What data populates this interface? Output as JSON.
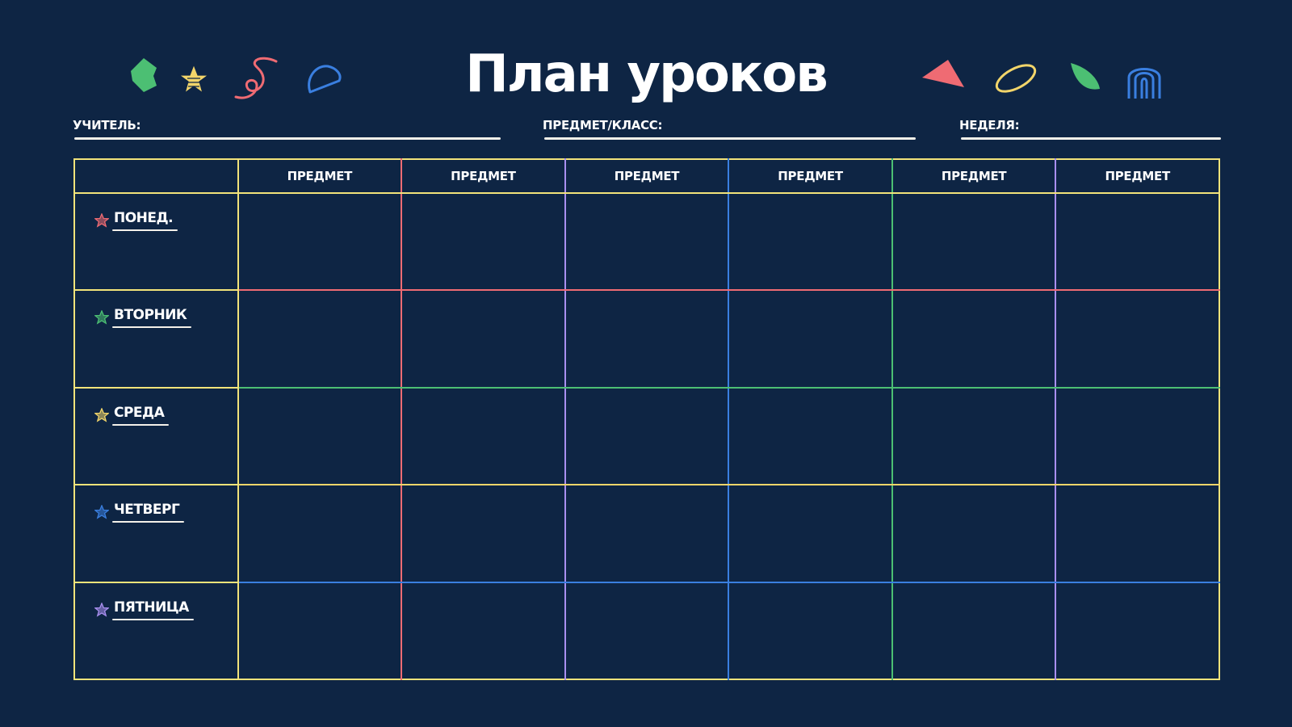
{
  "title": "План уроков",
  "fields": {
    "teacher_label": "УЧИТЕЛЬ:",
    "subject_label": "ПРЕДМЕТ/КЛАСС:",
    "week_label": "НЕДЕЛЯ:"
  },
  "table": {
    "columns": [
      "ПРЕДМЕТ",
      "ПРЕДМЕТ",
      "ПРЕДМЕТ",
      "ПРЕДМЕТ",
      "ПРЕДМЕТ",
      "ПРЕДМЕТ"
    ],
    "days": [
      {
        "label": "ПОНЕД.",
        "color": "#ef6b73"
      },
      {
        "label": "ВТОРНИК",
        "color": "#4cbf73"
      },
      {
        "label": "СРЕДА",
        "color": "#f2d56a"
      },
      {
        "label": "ЧЕТВЕРГ",
        "color": "#3a7fe0"
      },
      {
        "label": "ПЯТНИЦА",
        "color": "#a98ff0"
      }
    ],
    "column_colors": [
      "#f2e37a",
      "#ef6b73",
      "#a98ff0",
      "#3a7fe0",
      "#4cbf73",
      "#a98ff0"
    ],
    "border_color": "#f2e37a"
  },
  "colors": {
    "background": "#0e2544",
    "green": "#4cbf73",
    "yellow": "#f2d56a",
    "pink": "#ef6b73",
    "blue": "#3a7fe0"
  },
  "decorations": [
    "green-blob-icon",
    "yellow-star-icon",
    "pink-squiggle-icon",
    "blue-semicircle-icon",
    "pink-triangle-icon",
    "yellow-ring-icon",
    "green-leaf-icon",
    "blue-rainbow-icon"
  ]
}
